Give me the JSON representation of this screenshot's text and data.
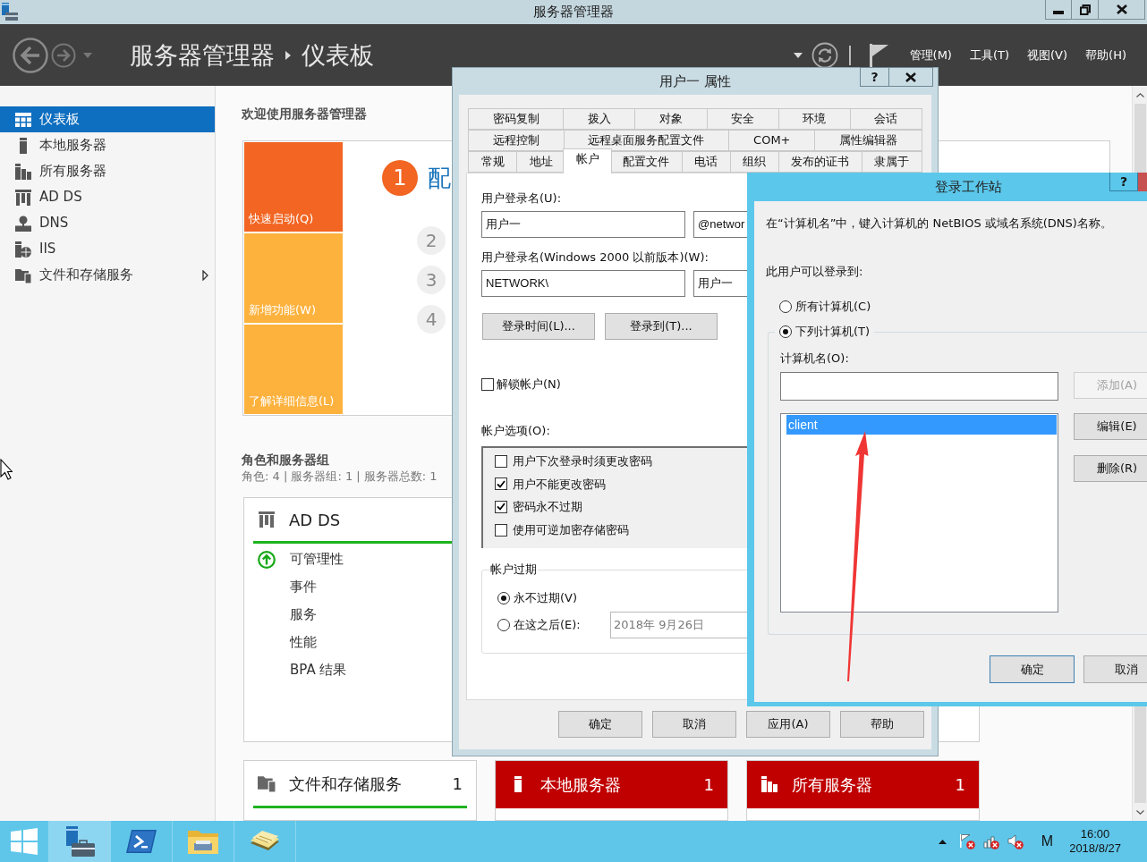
{
  "window": {
    "title": "服务器管理器"
  },
  "header": {
    "breadcrumb": [
      "服务器管理器",
      "仪表板"
    ],
    "menus": [
      "管理(M)",
      "工具(T)",
      "视图(V)",
      "帮助(H)"
    ]
  },
  "sidebar": {
    "items": [
      {
        "label": "仪表板",
        "selected": true,
        "expandable": false
      },
      {
        "label": "本地服务器",
        "selected": false,
        "expandable": false
      },
      {
        "label": "所有服务器",
        "selected": false,
        "expandable": false
      },
      {
        "label": "AD DS",
        "selected": false,
        "expandable": false
      },
      {
        "label": "DNS",
        "selected": false,
        "expandable": false
      },
      {
        "label": "IIS",
        "selected": false,
        "expandable": false
      },
      {
        "label": "文件和存储服务",
        "selected": false,
        "expandable": true
      }
    ]
  },
  "dashboard": {
    "welcome": "欢迎使用服务器管理器",
    "quick_start": {
      "tiles": [
        {
          "label": "快速启动(Q)",
          "selected": true
        },
        {
          "label": "新增功能(W)",
          "selected": false
        },
        {
          "label": "了解详细信息(L)",
          "selected": false
        }
      ],
      "steps": [
        {
          "number": "1",
          "title": "配",
          "selected": true
        },
        {
          "number": "2",
          "selected": false
        },
        {
          "number": "3",
          "selected": false
        },
        {
          "number": "4",
          "selected": false
        }
      ]
    },
    "roles": {
      "title": "角色和服务器组",
      "summary": "角色: 4 | 服务器组: 1 | 服务器总数: 1",
      "tiles": [
        {
          "name": "AD DS",
          "alert": false,
          "rows": [
            {
              "label": "可管理性",
              "kind": "status"
            },
            {
              "label": "事件",
              "kind": "link"
            },
            {
              "label": "服务",
              "kind": "link"
            },
            {
              "label": "性能",
              "kind": "link"
            },
            {
              "label": "BPA 结果",
              "kind": "link"
            }
          ]
        }
      ],
      "tile_row": [
        {
          "name": "文件和存储服务",
          "count": "1",
          "alert": false
        },
        {
          "name": "本地服务器",
          "count": "1",
          "alert": true
        },
        {
          "name": "所有服务器",
          "count": "1",
          "alert": true
        }
      ]
    }
  },
  "taskbar": {
    "apps": [
      {
        "selected": true
      },
      {
        "selected": false
      },
      {
        "selected": false
      },
      {
        "selected": false
      }
    ],
    "ime": "M",
    "clock": {
      "time": "16:00",
      "date": "2018/8/27"
    }
  },
  "properties_dialog": {
    "title": "用户一 属性",
    "help": "?",
    "tab_rows": [
      [
        {
          "label": "密码复制",
          "selected": false
        },
        {
          "label": "拨入",
          "selected": false
        },
        {
          "label": "对象",
          "selected": false
        },
        {
          "label": "安全",
          "selected": false
        },
        {
          "label": "环境",
          "selected": false
        },
        {
          "label": "会话",
          "selected": false
        }
      ],
      [
        {
          "label": "远程控制",
          "selected": false
        },
        {
          "label": "远程桌面服务配置文件",
          "selected": false
        },
        {
          "label": "COM+",
          "selected": false
        },
        {
          "label": "属性编辑器",
          "selected": false
        }
      ],
      [
        {
          "label": "常规",
          "selected": false
        },
        {
          "label": "地址",
          "selected": false
        },
        {
          "label": "帐户",
          "selected": true
        },
        {
          "label": "配置文件",
          "selected": false
        },
        {
          "label": "电话",
          "selected": false
        },
        {
          "label": "组织",
          "selected": false
        },
        {
          "label": "发布的证书",
          "selected": false
        },
        {
          "label": "隶属于",
          "selected": false
        }
      ]
    ],
    "logon_name": {
      "label": "用户登录名(U):",
      "value": "用户一",
      "suffix": "@networ"
    },
    "pre2000_name": {
      "label": "用户登录名(Windows 2000 以前版本)(W):",
      "domain": "NETWORK\\",
      "value": "用户一"
    },
    "action_buttons": [
      "登录时间(L)...",
      "登录到(T)..."
    ],
    "unlock": {
      "label": "解锁帐户(N)",
      "checked": false
    },
    "options": {
      "label": "帐户选项(O):",
      "items": [
        {
          "label": "用户下次登录时须更改密码",
          "checked": false
        },
        {
          "label": "用户不能更改密码",
          "checked": true
        },
        {
          "label": "密码永不过期",
          "checked": true
        },
        {
          "label": "使用可逆加密存储密码",
          "checked": false
        }
      ]
    },
    "expiry": {
      "title": "帐户过期",
      "choices": [
        {
          "label": "永不过期(V)",
          "selected": true
        },
        {
          "label": "在这之后(E):",
          "selected": false
        }
      ],
      "date": "2018年 9月26日"
    },
    "buttons": [
      "确定",
      "取消",
      "应用(A)",
      "帮助"
    ]
  },
  "workstations_dialog": {
    "title": "登录工作站",
    "help": "?",
    "description": "在“计算机名”中，键入计算机的 NetBIOS 或域名系统(DNS)名称。",
    "prompt": "此用户可以登录到:",
    "choices": [
      {
        "label": "所有计算机(C)",
        "selected": false
      },
      {
        "label": "下列计算机(T)",
        "selected": true
      }
    ],
    "computer_name_label": "计算机名(O):",
    "computers": [
      {
        "name": "client",
        "selected": true
      }
    ],
    "side_buttons": [
      {
        "label": "添加(A)",
        "disabled": true
      },
      {
        "label": "编辑(E)",
        "disabled": false
      },
      {
        "label": "删除(R)",
        "disabled": false
      }
    ],
    "buttons": [
      {
        "label": "确定",
        "default": true
      },
      {
        "label": "取消",
        "default": false
      }
    ]
  }
}
